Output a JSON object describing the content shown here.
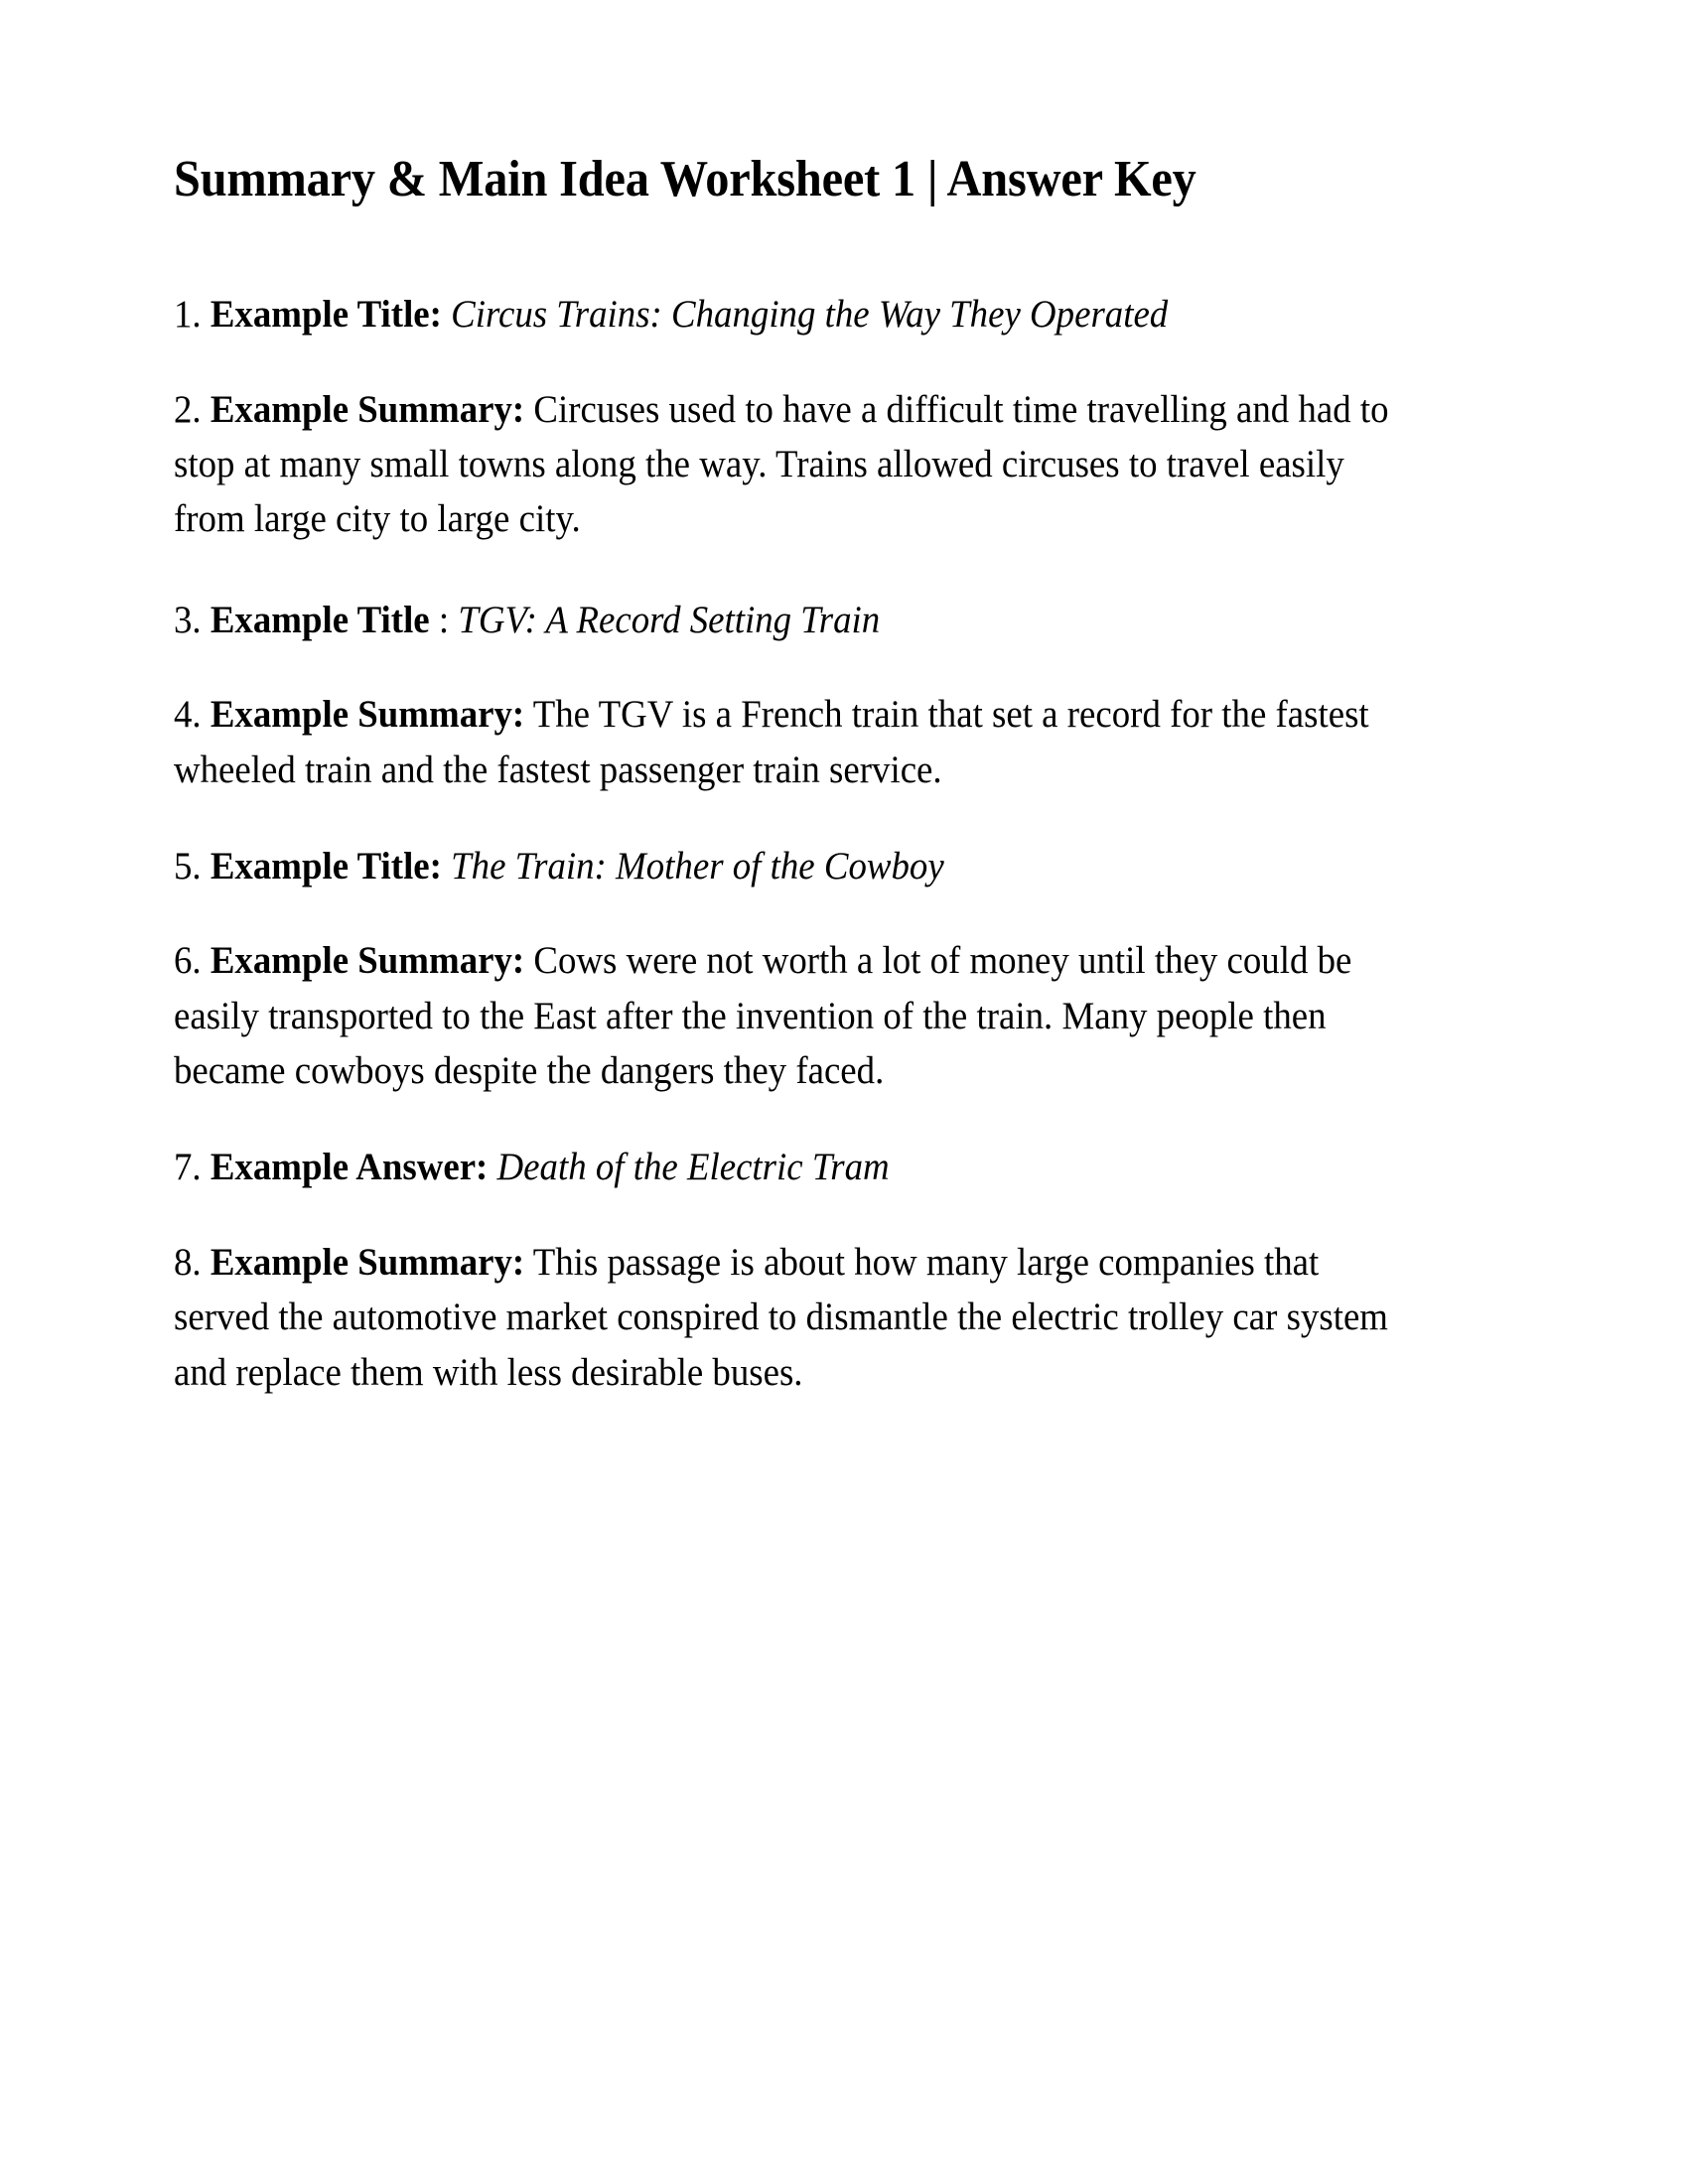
{
  "document": {
    "title": "Summary & Main Idea Worksheet 1 | Answer Key",
    "background_color": "#ffffff",
    "text_color": "#000000"
  },
  "answers": [
    {
      "number": "1.",
      "label": "Example Title:",
      "separator": "",
      "value": "Circus Trains: Changing the Way They Operated",
      "style": "italic"
    },
    {
      "number": "2.",
      "label": "Example Summary:",
      "separator": "",
      "value": "Circuses used to have a difficult time travelling and had to stop at many small towns along the way.  Trains allowed circuses to travel easily from large city to large city.",
      "style": "plain"
    },
    {
      "number": "3.",
      "label": "Example Title",
      "separator": ": ",
      "value": "TGV: A Record Setting Train",
      "style": "italic"
    },
    {
      "number": "4.",
      "label": "Example Summary:",
      "separator": "",
      "value": "The TGV is a French train that set a record for the fastest wheeled train and the fastest passenger train service.",
      "style": "plain"
    },
    {
      "number": "5.",
      "label": "Example Title:",
      "separator": "",
      "value": "The Train: Mother of the Cowboy",
      "style": "italic"
    },
    {
      "number": "6.",
      "label": "Example Summary:",
      "separator": "",
      "value": "Cows were not worth a lot of money until they could be easily transported to the East after the invention of the train.  Many people then became cowboys despite the dangers they faced.",
      "style": "plain"
    },
    {
      "number": "7.",
      "label": "Example Answer:",
      "separator": "",
      "value": "Death of the Electric Tram",
      "style": "italic"
    },
    {
      "number": "8.",
      "label": "Example Summary:",
      "separator": "",
      "value": "This passage is about how many large companies that served the automotive market conspired to dismantle the electric trolley car system and replace them with less desirable buses.",
      "style": "plain"
    }
  ]
}
